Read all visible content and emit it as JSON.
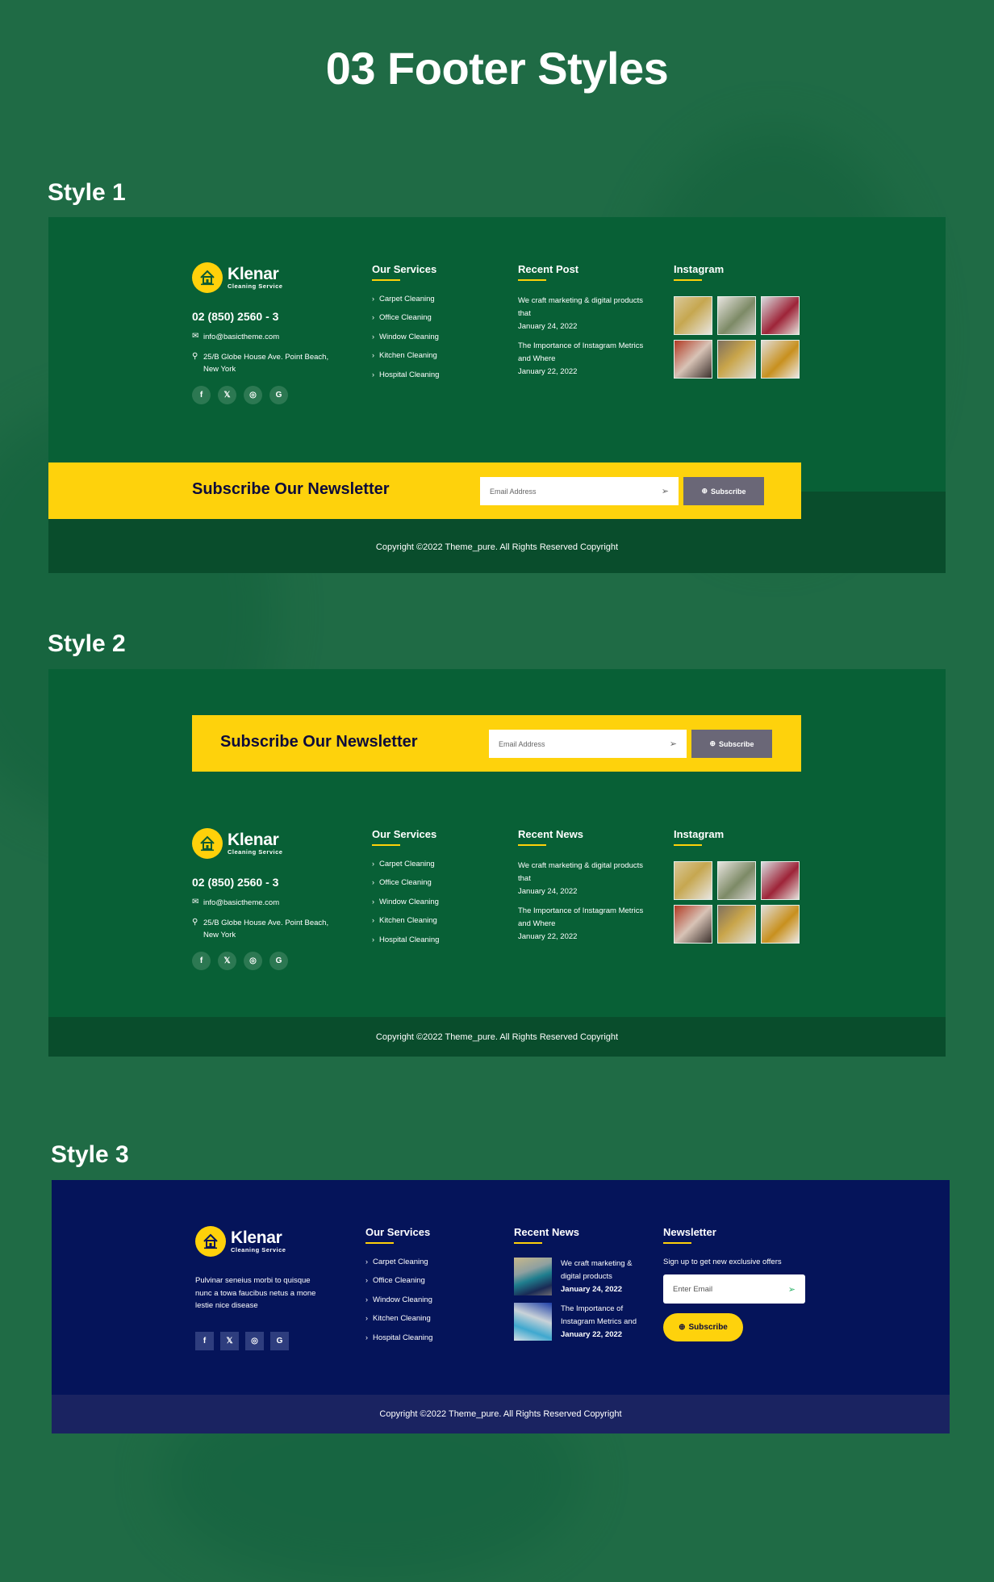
{
  "page": {
    "title": "03 Footer Styles",
    "colors": {
      "background": "#1f6b45",
      "footer_green": "#086036",
      "copyright_green": "#094d2c",
      "footer_navy": "#05145a",
      "copyright_navy": "#1a2361",
      "accent_yellow": "#fed20c",
      "button_gray": "#6a6777"
    }
  },
  "brand": {
    "name": "Klenar",
    "tagline": "Cleaning Service",
    "logo_icon": "house-icon"
  },
  "contact": {
    "phone": "02 (850) 2560 - 3",
    "email": "info@basictheme.com",
    "email_icon": "envelope-icon",
    "address": "25/B Globe House Ave. Point Beach, New York",
    "address_icon": "map-pin-icon"
  },
  "socials": [
    {
      "icon": "facebook-icon",
      "glyph": "f"
    },
    {
      "icon": "twitter-icon",
      "glyph": "🐦"
    },
    {
      "icon": "instagram-icon",
      "glyph": "◎"
    },
    {
      "icon": "google-icon",
      "glyph": "G"
    }
  ],
  "services": {
    "title": "Our Services",
    "items": [
      "Carpet Cleaning",
      "Office Cleaning",
      "Window Cleaning",
      "Kitchen Cleaning",
      "Hospital Cleaning"
    ]
  },
  "posts": [
    {
      "title": "We craft marketing & digital products that",
      "date": "January 24, 2022"
    },
    {
      "title": "The Importance of Instagram Metrics and Where",
      "date": "January 22, 2022"
    }
  ],
  "instagram": {
    "title": "Instagram",
    "photos": [
      {
        "alt": "two people working at laptops"
      },
      {
        "alt": "woman with laptop"
      },
      {
        "alt": "man in red shirt"
      },
      {
        "alt": "woman smiling at desk"
      },
      {
        "alt": "group at table"
      },
      {
        "alt": "woman with headphones writing"
      }
    ]
  },
  "newsletter_bar": {
    "title": "Subscribe Our Newsletter",
    "email_placeholder": "Email Address",
    "send_icon": "paper-plane-icon",
    "button_label": "Subscribe",
    "button_icon": "arrow-circle-icon"
  },
  "copyright": "Copyright ©2022 Theme_pure. All Rights Reserved Copyright",
  "style1": {
    "label": "Style 1",
    "posts_title": "Recent Post"
  },
  "style2": {
    "label": "Style 2",
    "posts_title": "Recent News"
  },
  "style3": {
    "label": "Style 3",
    "description": "Pulvinar seneius morbi to quisque nunc a towa faucibus netus a mone lestie nice disease",
    "news_title": "Recent News",
    "news": [
      {
        "title": "We craft marketing & digital products",
        "date": "January 24, 2022",
        "thumb": "cleaning cloth photo"
      },
      {
        "title": "The Importance of Instagram Metrics and",
        "date": "January 22, 2022",
        "thumb": "gloved hand spraying photo"
      }
    ],
    "newsletter": {
      "title": "Newsletter",
      "text": "Sign up to get new exclusive offers",
      "placeholder": "Enter Email",
      "button_label": "Subscribe"
    }
  }
}
